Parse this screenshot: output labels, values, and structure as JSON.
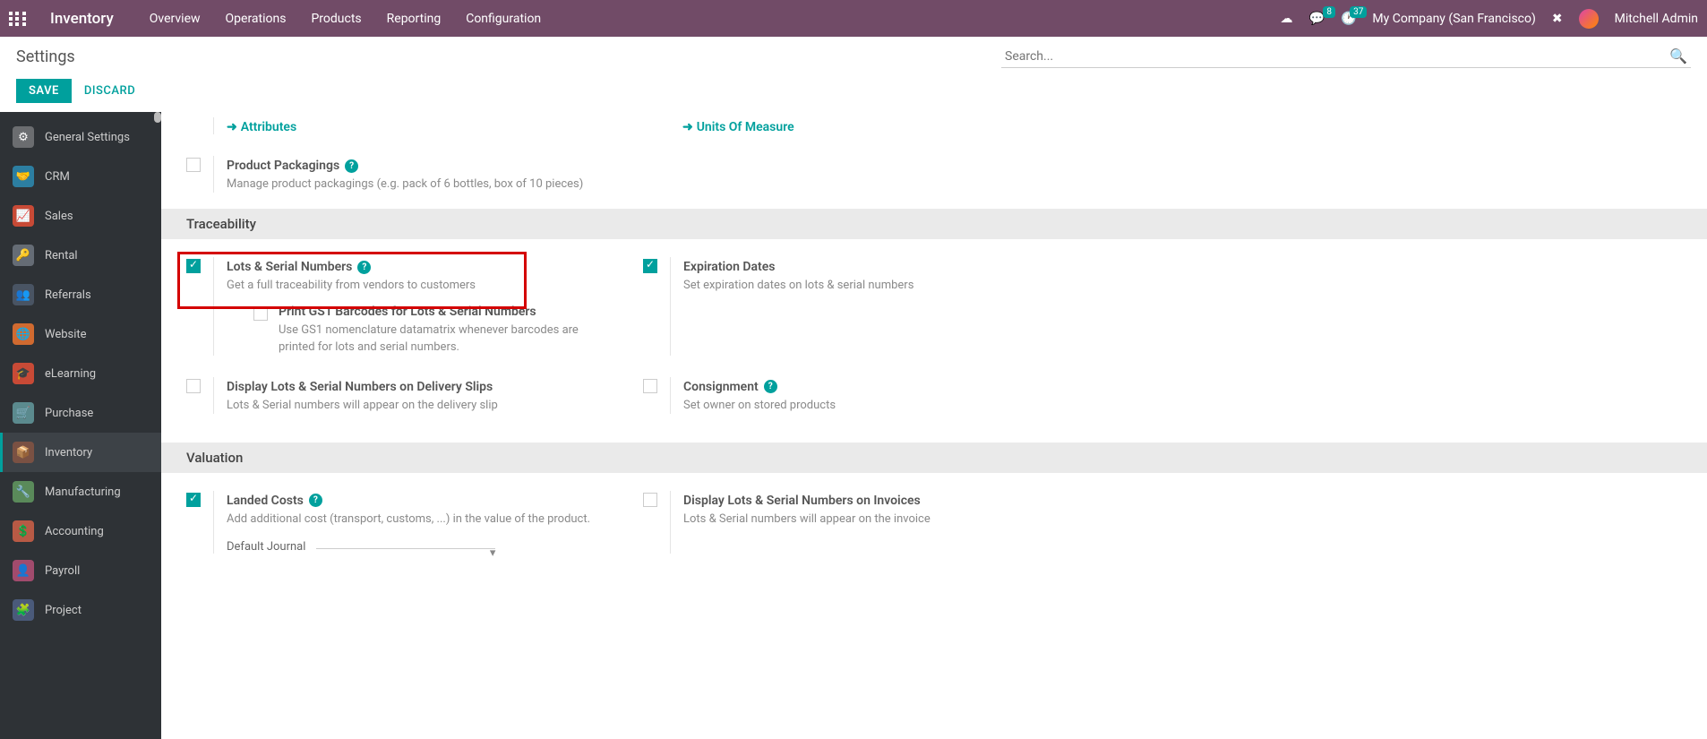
{
  "topnav": {
    "title": "Inventory",
    "menu": [
      "Overview",
      "Operations",
      "Products",
      "Reporting",
      "Configuration"
    ],
    "msg_badge": "8",
    "clock_badge": "37",
    "company": "My Company (San Francisco)",
    "user": "Mitchell Admin"
  },
  "page": {
    "title": "Settings",
    "save": "SAVE",
    "discard": "DISCARD",
    "search_placeholder": "Search..."
  },
  "sidebar": {
    "items": [
      {
        "label": "General Settings"
      },
      {
        "label": "CRM"
      },
      {
        "label": "Sales"
      },
      {
        "label": "Rental"
      },
      {
        "label": "Referrals"
      },
      {
        "label": "Website"
      },
      {
        "label": "eLearning"
      },
      {
        "label": "Purchase"
      },
      {
        "label": "Inventory"
      },
      {
        "label": "Manufacturing"
      },
      {
        "label": "Accounting"
      },
      {
        "label": "Payroll"
      },
      {
        "label": "Project"
      }
    ],
    "active_index": 8
  },
  "links": {
    "attributes": "Attributes",
    "uom": "Units Of Measure"
  },
  "settings": {
    "packagings": {
      "label": "Product Packagings",
      "desc": "Manage product packagings (e.g. pack of 6 bottles, box of 10 pieces)",
      "checked": false
    },
    "section_traceability": "Traceability",
    "lots": {
      "label": "Lots & Serial Numbers",
      "desc": "Get a full traceability from vendors to customers",
      "checked": true
    },
    "gs1": {
      "label": "Print GS1 Barcodes for Lots & Serial Numbers",
      "desc": "Use GS1 nomenclature datamatrix whenever barcodes are printed for lots and serial numbers.",
      "checked": false
    },
    "expiration": {
      "label": "Expiration Dates",
      "desc": "Set expiration dates on lots & serial numbers",
      "checked": true
    },
    "delivery_slips": {
      "label": "Display Lots & Serial Numbers on Delivery Slips",
      "desc": "Lots & Serial numbers will appear on the delivery slip",
      "checked": false
    },
    "consignment": {
      "label": "Consignment",
      "desc": "Set owner on stored products",
      "checked": false
    },
    "section_valuation": "Valuation",
    "landed": {
      "label": "Landed Costs",
      "desc": "Add additional cost (transport, customs, ...) in the value of the product.",
      "checked": true,
      "journal_label": "Default Journal"
    },
    "invoices": {
      "label": "Display Lots & Serial Numbers on Invoices",
      "desc": "Lots & Serial numbers will appear on the invoice",
      "checked": false
    }
  }
}
